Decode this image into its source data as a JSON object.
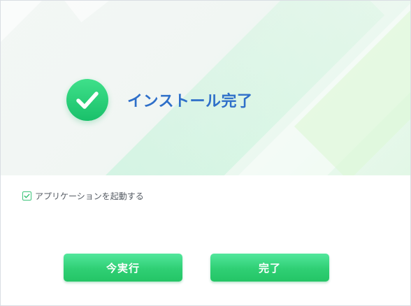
{
  "window": {
    "title": "インストール完了"
  },
  "hero": {
    "status_icon": "check-circle-icon",
    "accent_color": "#1fc46e",
    "title_color": "#2e6fc9"
  },
  "options": {
    "launch_app": {
      "label": "アプリケーションを起動する",
      "checked": true
    }
  },
  "buttons": {
    "run_now": "今実行",
    "finish": "完了"
  }
}
